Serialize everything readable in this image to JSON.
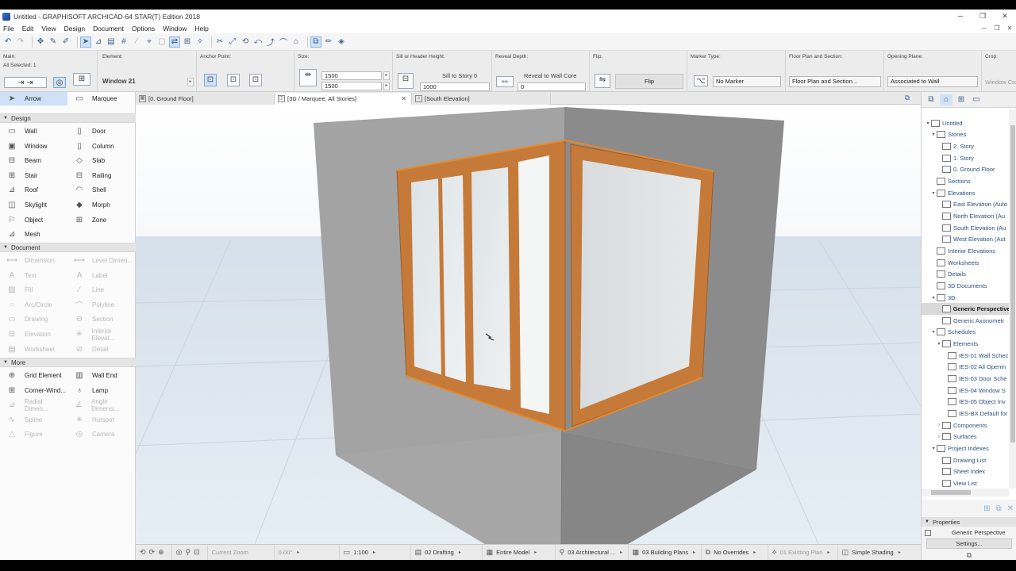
{
  "window": {
    "title": "Untitled - GRAPHISOFT ARCHICAD-64 STAR(T) Edition 2018",
    "controls": [
      "─",
      "❐",
      "✕"
    ]
  },
  "menu": [
    "File",
    "Edit",
    "View",
    "Design",
    "Document",
    "Options",
    "Window",
    "Help"
  ],
  "mdi_controls": [
    "─",
    "❐",
    "✕"
  ],
  "infobox": {
    "main_label": "Main:",
    "all_selected": "All Selected: 1",
    "element_label": "Element:",
    "element_value": "Window 21",
    "anchor_label": "Anchor Point:",
    "size_label": "Size:",
    "width": "1500",
    "height": "1500",
    "sill_label": "Sill or Header Height:",
    "sill_ref": "Sill to Story 0",
    "sill_value": "1000",
    "reveal_label": "Reveal Depth:",
    "reveal_ref": "Reveal to Wall Core",
    "reveal_value": "0",
    "flip_label": "Flip:",
    "flip_button": "Flip",
    "marker_label": "Marker Type:",
    "marker_value": "No Marker",
    "plan_label": "Floor Plan and Section:",
    "plan_value": "Floor Plan and Section...",
    "opening_label": "Opening Plane:",
    "opening_value": "Associated to Wall",
    "crop_label": "Crop:",
    "crop_value": "Window Cro"
  },
  "toolbox": {
    "arrow": "Arrow",
    "marquee": "Marquee",
    "sections": {
      "design": "Design",
      "document": "Document",
      "more": "More"
    },
    "design": [
      [
        "Wall",
        "Door"
      ],
      [
        "Window",
        "Column"
      ],
      [
        "Beam",
        "Slab"
      ],
      [
        "Stair",
        "Railing"
      ],
      [
        "Roof",
        "Shell"
      ],
      [
        "Skylight",
        "Morph"
      ],
      [
        "Object",
        "Zone"
      ],
      [
        "Mesh",
        ""
      ]
    ],
    "document": [
      [
        "Dimension",
        "Level Dimen..."
      ],
      [
        "Text",
        "Label"
      ],
      [
        "Fill",
        "Line"
      ],
      [
        "Arc/Circle",
        "Polyline"
      ],
      [
        "Drawing",
        "Section"
      ],
      [
        "Elevation",
        "Interior Elevat..."
      ],
      [
        "Worksheet",
        "Detail"
      ]
    ],
    "more": [
      [
        "Grid Element",
        "Wall End"
      ],
      [
        "Corner-Wind...",
        "Lamp"
      ],
      [
        "Radial Dimen...",
        "Angle Dimensi..."
      ],
      [
        "Spline",
        "Hotspot"
      ],
      [
        "Figure",
        "Camera"
      ]
    ]
  },
  "tabs": [
    "[0. Ground Floor]",
    "[3D / Marquee, All Stories]",
    "[South Elevation]"
  ],
  "tab_close": "✕",
  "statusbar": {
    "zoom": "Current Zoom",
    "angle": "0.00°",
    "scale": "1:100",
    "layer": "02 Drafting",
    "model": "Entire Model",
    "pen": "03 Architectural ...",
    "mvo": "03 Building Plans",
    "overrides": "No Overrides",
    "renovation": "01 Existing Plan",
    "shading": "Simple Shading"
  },
  "navigator": {
    "tree": [
      {
        "label": "Untitled",
        "level": 0,
        "exp": "▾"
      },
      {
        "label": "Stories",
        "level": 1,
        "exp": "▾"
      },
      {
        "label": "2. Story",
        "level": 2,
        "exp": ""
      },
      {
        "label": "1. Story",
        "level": 2,
        "exp": ""
      },
      {
        "label": "0. Ground Floor",
        "level": 2,
        "exp": ""
      },
      {
        "label": "Sections",
        "level": 1,
        "exp": ""
      },
      {
        "label": "Elevations",
        "level": 1,
        "exp": "▾"
      },
      {
        "label": "East Elevation (Auto",
        "level": 2,
        "exp": ""
      },
      {
        "label": "North Elevation (Au",
        "level": 2,
        "exp": ""
      },
      {
        "label": "South Elevation (Au",
        "level": 2,
        "exp": ""
      },
      {
        "label": "West Elevation (Aut",
        "level": 2,
        "exp": ""
      },
      {
        "label": "Interior Elevations",
        "level": 1,
        "exp": ""
      },
      {
        "label": "Worksheets",
        "level": 1,
        "exp": ""
      },
      {
        "label": "Details",
        "level": 1,
        "exp": ""
      },
      {
        "label": "3D Documents",
        "level": 1,
        "exp": ""
      },
      {
        "label": "3D",
        "level": 1,
        "exp": "▾"
      },
      {
        "label": "Generic Perspective",
        "level": 2,
        "exp": "",
        "selected": true
      },
      {
        "label": "Generic Axonometr",
        "level": 2,
        "exp": ""
      },
      {
        "label": "Schedules",
        "level": 1,
        "exp": "▾"
      },
      {
        "label": "Elements",
        "level": 2,
        "exp": "▾"
      },
      {
        "label": "IES-01 Wall Schec",
        "level": 3,
        "exp": ""
      },
      {
        "label": "IES-02 All Openin",
        "level": 3,
        "exp": ""
      },
      {
        "label": "IES-03 Door Sche",
        "level": 3,
        "exp": ""
      },
      {
        "label": "IES-04 Window S",
        "level": 3,
        "exp": ""
      },
      {
        "label": "IES-05 Object Inv",
        "level": 3,
        "exp": ""
      },
      {
        "label": "IES-BX Default for",
        "level": 3,
        "exp": ""
      },
      {
        "label": "Components",
        "level": 2,
        "exp": "›"
      },
      {
        "label": "Surfaces",
        "level": 2,
        "exp": "›"
      },
      {
        "label": "Project Indexes",
        "level": 1,
        "exp": "▾"
      },
      {
        "label": "Drawing List",
        "level": 2,
        "exp": ""
      },
      {
        "label": "Sheet Index",
        "level": 2,
        "exp": ""
      },
      {
        "label": "View List",
        "level": 2,
        "exp": ""
      }
    ]
  },
  "properties": {
    "header": "Properties",
    "view_name": "Generic Perspective",
    "settings_button": "Settings..."
  }
}
